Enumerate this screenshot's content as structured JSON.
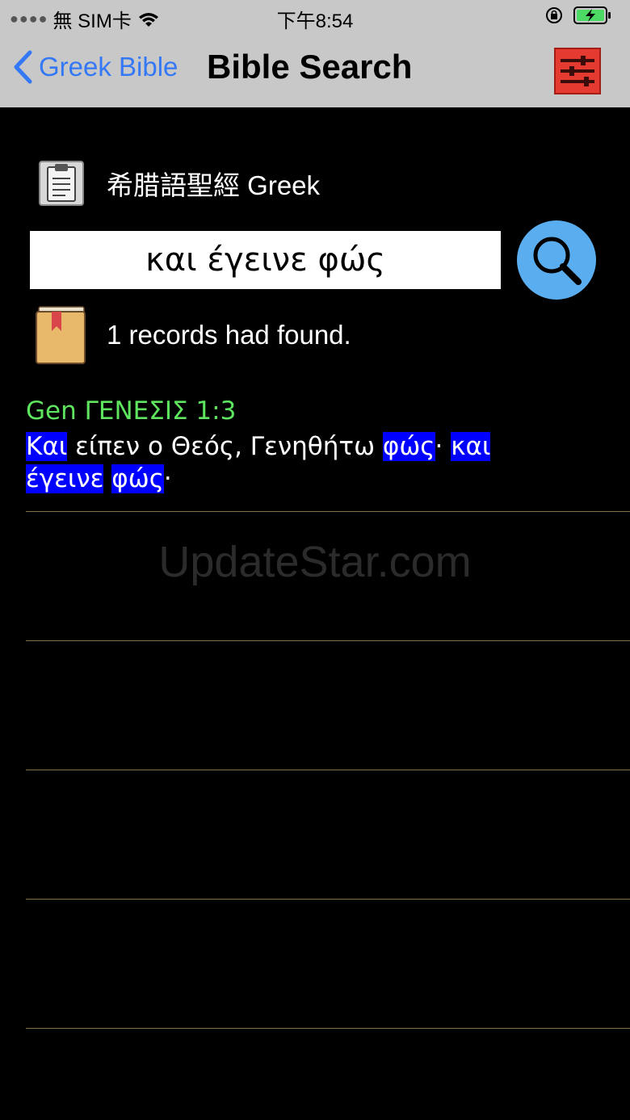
{
  "status_bar": {
    "carrier": "無 SIM卡",
    "time": "下午8:54"
  },
  "nav": {
    "back_label": "Greek Bible",
    "title": "Bible Search"
  },
  "version": {
    "label": "希腊語聖經 Greek"
  },
  "search": {
    "value": "και έγεινε φώς"
  },
  "results": {
    "count_text": "1 records had found."
  },
  "verse": {
    "reference": "Gen ΓΕΝΕΣΙΣ 1:3",
    "parts": {
      "p1": "Και",
      "p2": " είπεν ο Θεός, Γενηθήτω ",
      "p3": "φώς",
      "p4": "· ",
      "p5": "και",
      "p6": "έγεινε",
      "p7": " ",
      "p8": "φώς",
      "p9": "·"
    }
  },
  "watermark": "UpdateStar.com",
  "colors": {
    "accent": "#3478f6",
    "reference": "#5ee45e",
    "highlight": "#0000ff",
    "search_button": "#5aaef0",
    "separator": "#8a6a4a"
  }
}
